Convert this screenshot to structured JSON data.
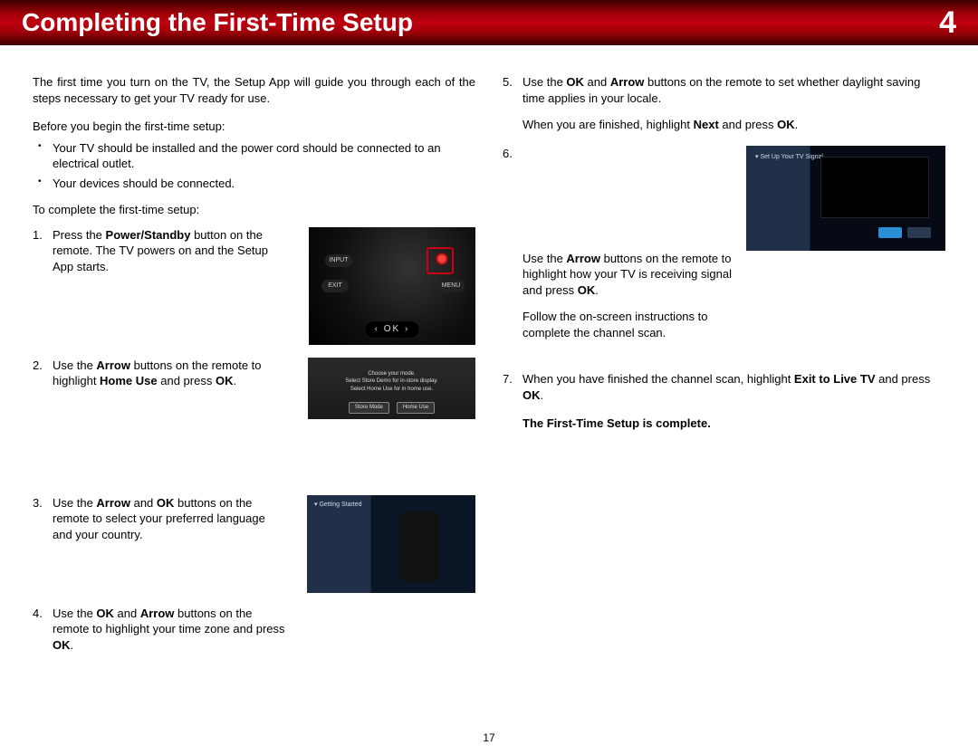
{
  "header": {
    "title": "Completing the First-Time Setup",
    "chapter": "4"
  },
  "left": {
    "intro": "The first time you turn on the TV, the Setup App will guide you through each of the steps necessary to get your TV ready for use.",
    "before_heading": "Before you begin the first-time setup:",
    "bullets": [
      "Your TV should be installed and the power cord should be connected to an electrical outlet.",
      "Your devices should be connected."
    ],
    "to_complete": "To complete the first-time setup:",
    "steps": {
      "s1a": "Press the ",
      "s1b": "Power/Standby",
      "s1c": " button on the remote. The TV powers on and the Setup App starts.",
      "s2a": "Use the ",
      "s2b": "Arrow",
      "s2c": " buttons on the remote to highlight ",
      "s2d": "Home Use",
      "s2e": " and press ",
      "s2f": "OK",
      "s2g": ".",
      "s3a": "Use the ",
      "s3b": "Arrow",
      "s3c": " and ",
      "s3d": "OK",
      "s3e": " buttons on the remote to select your preferred language and your country.",
      "s4a": "Use the ",
      "s4b": "OK",
      "s4c": " and ",
      "s4d": "Arrow",
      "s4e": " buttons on the remote to highlight your time zone and press ",
      "s4f": "OK",
      "s4g": "."
    },
    "fig_remote": {
      "ok": "‹  OK  ›",
      "input": "INPUT",
      "exit": "EXIT",
      "menu": "MENU"
    },
    "fig_choose": {
      "l1": "Choose your mode.",
      "l2": "Select Store Demo for in-store display.",
      "l3": "Select Home Use for in home use.",
      "b1": "Store Mode",
      "b2": "Home Use"
    },
    "fig_lang": {
      "gs": "▾ Getting Started"
    }
  },
  "right": {
    "steps": {
      "s5a": "Use the ",
      "s5b": "OK",
      "s5c": " and ",
      "s5d": "Arrow",
      "s5e": " buttons on the remote to set whether daylight saving time applies in your locale.",
      "s5f": "When you are finished, highlight ",
      "s5g": "Next",
      "s5h": " and press ",
      "s5i": "OK",
      "s5j": ".",
      "s6a": "Use the ",
      "s6b": "Arrow",
      "s6c": " buttons on the remote to highlight how your TV is receiving signal and press ",
      "s6d": "OK",
      "s6e": ".",
      "s6f": "Follow the on-screen instructions to complete the channel scan.",
      "s7a": "When you have finished the channel scan, highlight ",
      "s7b": "Exit to Live TV",
      "s7c": " and press ",
      "s7d": "OK",
      "s7e": "."
    },
    "fig_signal": {
      "ttl": "▾ Set Up Your\n   TV Signal"
    },
    "complete": "The First-Time Setup is complete."
  },
  "page_number": "17"
}
